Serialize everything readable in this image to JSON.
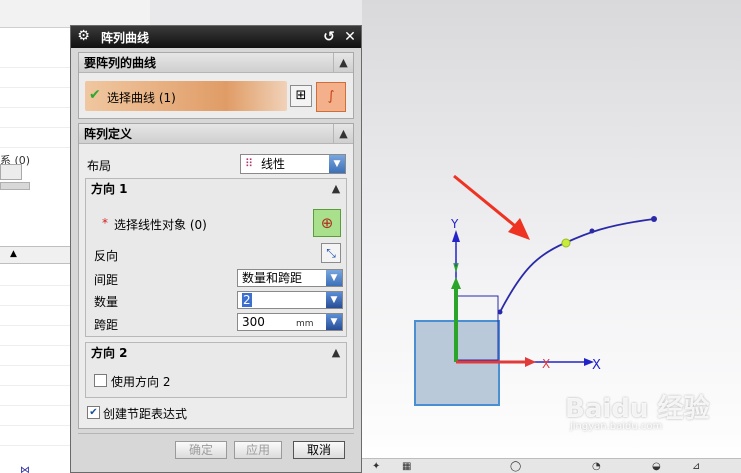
{
  "dialog": {
    "title": "阵列曲线",
    "close_symbol": "✕",
    "reset_symbol": "↺",
    "section_curve": {
      "title": "要阵列的曲线",
      "select_label": "选择曲线 (1)"
    },
    "section_define": {
      "title": "阵列定义",
      "layout_label": "布局",
      "layout_value": "线性",
      "direction1": {
        "title": "方向 1",
        "required_mark": "*",
        "select_object_label": "选择线性对象 (0)",
        "reverse_label": "反向",
        "spacing_label": "间距",
        "spacing_value": "数量和跨距",
        "count_label": "数量",
        "count_value": "2",
        "span_label": "跨距",
        "span_value": "300",
        "span_unit": "mm"
      },
      "direction2": {
        "title": "方向 2",
        "use_label": "使用方向 2",
        "use_checked": false
      },
      "create_expr_label": "创建节距表达式",
      "create_expr_checked": true
    },
    "buttons": {
      "ok": "确定",
      "apply": "应用",
      "cancel": "取消"
    }
  },
  "left_panel": {
    "fragment_text": "系 (0)"
  },
  "viewport": {
    "axis_y": "Y",
    "axis_x": "X",
    "axis_x2": "X"
  },
  "watermark": {
    "brand": "Baidu 经验",
    "url": "jingyan.baidu.com"
  },
  "colors": {
    "title_bar": "#1a1a1a",
    "selection_highlight": "#e09c66",
    "curve": "#2a2aa8",
    "arrow": "#ee3322",
    "y_axis_green": "#2aa52a",
    "x_axis_red": "#e03a3a"
  }
}
